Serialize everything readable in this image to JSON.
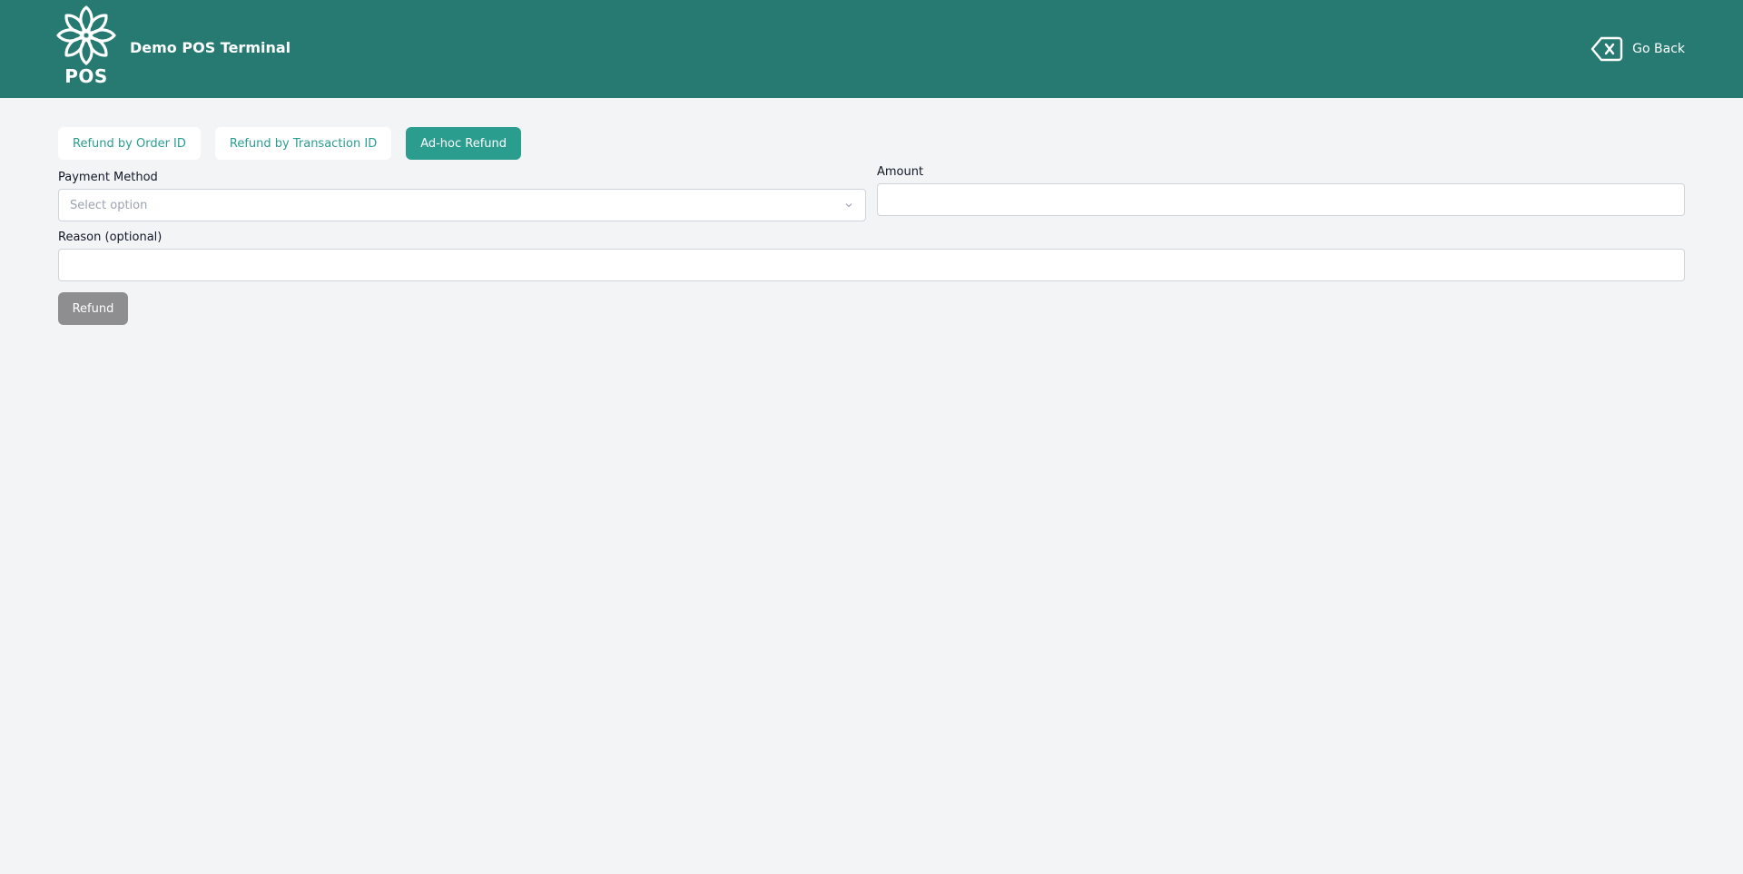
{
  "header": {
    "logo_text": "POS",
    "app_title": "Demo POS Terminal",
    "go_back_label": "Go Back"
  },
  "tabs": [
    {
      "label": "Refund by Order ID",
      "active": false
    },
    {
      "label": "Refund by Transaction ID",
      "active": false
    },
    {
      "label": "Ad-hoc Refund",
      "active": true
    }
  ],
  "form": {
    "payment_method_label": "Payment Method",
    "payment_method_placeholder": "Select option",
    "amount_label": "Amount",
    "amount_value": "",
    "reason_label": "Reason (optional)",
    "reason_value": "",
    "submit_label": "Refund"
  },
  "colors": {
    "header_bg": "#267a72",
    "accent": "#2a9d8f",
    "disabled_button": "#8e8e90",
    "page_bg": "#f3f4f6"
  },
  "icons": {
    "logo": "flower-logo-icon",
    "go_back": "backspace-x-icon",
    "select_arrow": "chevron-down-icon"
  }
}
